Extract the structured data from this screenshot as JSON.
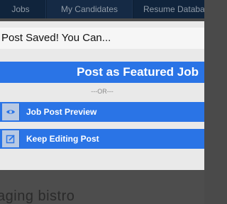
{
  "nav": {
    "tabs": [
      "Jobs",
      "My Candidates",
      "Resume Databa"
    ]
  },
  "modal": {
    "title": "Post Saved! You Can...",
    "featured_button": "Post as Featured Job",
    "divider": "---OR---",
    "actions": [
      {
        "label": "Job Post Preview",
        "icon": "eye-icon"
      },
      {
        "label": "Keep Editing Post",
        "icon": "edit-icon"
      }
    ]
  },
  "background": {
    "heading": "aging bistro"
  },
  "colors": {
    "accent": "#2a74e6",
    "nav_bg": "#0d1f33",
    "modal_bg": "#e9e9e9",
    "overlay": "#4a4a4a"
  }
}
